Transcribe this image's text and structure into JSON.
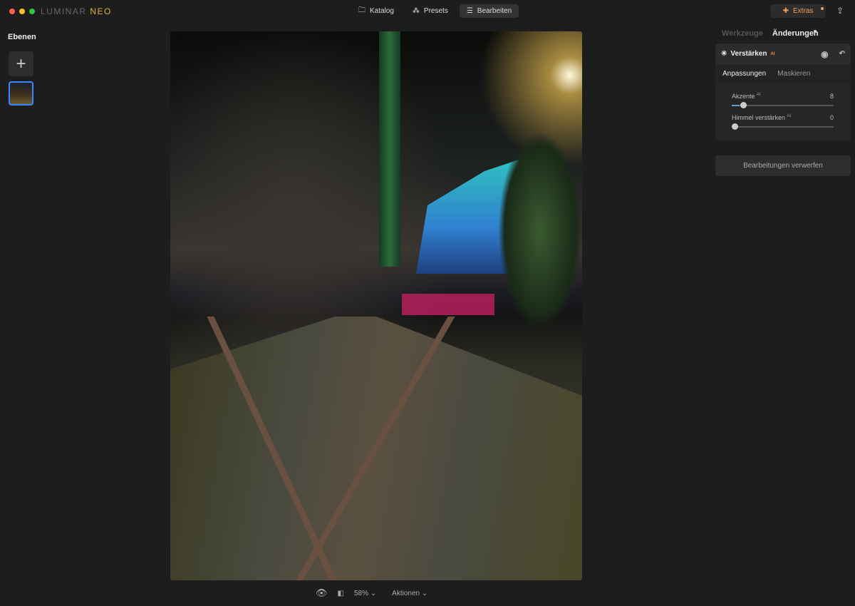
{
  "app": {
    "logo_main": "LUMINAR",
    "logo_accent": "NEO"
  },
  "nav": {
    "tabs": [
      {
        "label": "Katalog",
        "icon": "folder-icon"
      },
      {
        "label": "Presets",
        "icon": "sparkle-icon"
      },
      {
        "label": "Bearbeiten",
        "icon": "sliders-icon",
        "active": true
      }
    ],
    "extras": "Extras"
  },
  "left": {
    "title": "Ebenen"
  },
  "right": {
    "tabs": [
      "Werkzeuge",
      "Änderungen"
    ],
    "tool": {
      "name": "Verstärken",
      "badge": "AI",
      "subtabs": [
        "Anpassungen",
        "Maskieren"
      ],
      "sliders": [
        {
          "label": "Akzente",
          "badge": "AI",
          "value": 8,
          "fraction": 0.08
        },
        {
          "label": "Himmel verstärken",
          "badge": "AI",
          "value": 0,
          "fraction": 0
        }
      ]
    },
    "discard": "Bearbeitungen verwerfen"
  },
  "bottom": {
    "zoom": "58%",
    "actions": "Aktionen"
  },
  "colors": {
    "accent": "#3a86ff",
    "extras": "#f0a060"
  }
}
